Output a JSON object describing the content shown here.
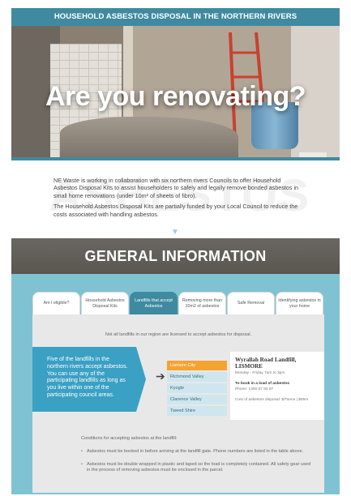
{
  "header": {
    "title": "HOUSEHOLD ASBESTOS DISPOSAL IN THE NORTHERN RIVERS"
  },
  "hero": {
    "title": "Are you renovating?"
  },
  "intro": {
    "watermark": "ASBESTOS",
    "paragraph_1": "NE Waste is working in collaboration with six northern rivers Councils to offer Household Asbestos Disposal Kits to assist householders to safely and legally remove bonded asbestos in small home renovations (under 10m² of sheets of fibro).",
    "paragraph_2": "The Household Asbestos Disposal Kits are partially funded by your Local Council to reduce the costs associated with handling asbestos."
  },
  "general": {
    "title": "GENERAL INFORMATION"
  },
  "tabs": [
    {
      "label": "Am I eligible?"
    },
    {
      "label": "Household Asbestos Disposal Kits"
    },
    {
      "label": "Landfills that accept Asbestos"
    },
    {
      "label": "Removing more than 10m2 of asbestos"
    },
    {
      "label": "Safe Removal"
    },
    {
      "label": "Identifying asbestos in your home"
    }
  ],
  "panel": {
    "notice": "Not all landfills in our region are licensed to accept asbestos for disposal.",
    "callout": "Five of the landfills in the northern rivers accept asbestos. You can use any of the participating landfills as long as you live within one of the participating council areas.",
    "landfills": [
      "Lismore City",
      "Richmond Valley",
      "Kyogle",
      "Clarence Valley",
      "Tweed Shire"
    ],
    "detail": {
      "heading": "Wyrallah Road Landfill, LISMORE",
      "hours": "Monday - Friday 7am to 3pm.",
      "book": "To book in a load of asbestos",
      "phone": "Phone: 1300 87 83 87",
      "cost": "Cost of asbestos disposal: $/Tonne | $55m"
    },
    "conditions_title": "Conditions for accepting asbestos at the landfill:",
    "conditions": [
      "Asbestos must be booked in before arriving at the landfill gate. Phone numbers are listed in the table above.",
      "Asbestos must be double wrapped in plastic and taped so the load is completely contained. All safety gear used in the process of removing asbestos must be enclosed in the parcel."
    ]
  },
  "colors": {
    "accent": "#3f8aa0",
    "section_bg": "#7fc3d3",
    "highlight": "#f4a331",
    "callout": "#3aa0c4"
  }
}
